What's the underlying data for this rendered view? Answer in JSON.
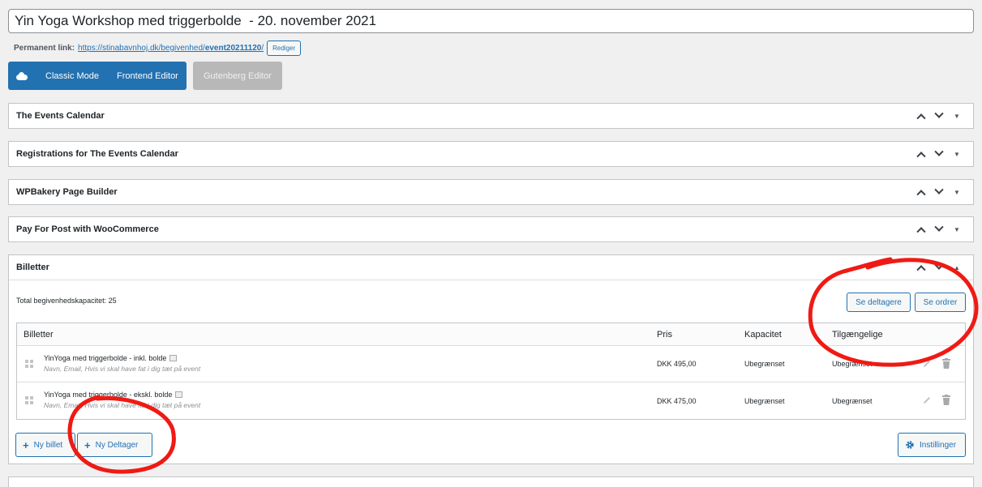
{
  "post_title": "Yin Yoga Workshop med triggerbolde  - 20. november 2021",
  "permalink": {
    "label": "Permanent link:",
    "url_prefix": "https://stinabavnhoj.dk/begivenhed/",
    "url_slug": "event20211120",
    "url_suffix": "/",
    "edit_label": "Rediger"
  },
  "editor_bar": {
    "classic_mode": "Classic Mode",
    "frontend_editor": "Frontend Editor",
    "gutenberg_editor": "Gutenberg Editor"
  },
  "metaboxes": [
    {
      "title": "The Events Calendar"
    },
    {
      "title": "Registrations for The Events Calendar"
    },
    {
      "title": "WPBakery Page Builder"
    },
    {
      "title": "Pay For Post with WooCommerce"
    }
  ],
  "billetter": {
    "title": "Billetter",
    "capacity_text": "Total begivenhedskapacitet: 25",
    "see_attendees": "Se deltagere",
    "see_orders": "Se ordrer",
    "table": {
      "headers": {
        "name": "Billetter",
        "price": "Pris",
        "capacity": "Kapacitet",
        "available": "Tilgængelige"
      },
      "rows": [
        {
          "name": "YinYoga med triggerbolde - inkl. bolde",
          "desc": "Navn, Email, Hvis vi skal have fat i dig tæt på event",
          "price": "DKK 495,00",
          "capacity": "Ubegrænset",
          "available": "Ubegrænset"
        },
        {
          "name": "YinYoga med triggerbolde - ekskl. bolde",
          "desc": "Navn, Email, Hvis vi skal have fat i dig tæt på event",
          "price": "DKK 475,00",
          "capacity": "Ubegrænset",
          "available": "Ubegrænset"
        }
      ]
    },
    "new_ticket": "Ny billet",
    "new_attendee": "Ny Deltager",
    "settings": "Instillinger"
  }
}
